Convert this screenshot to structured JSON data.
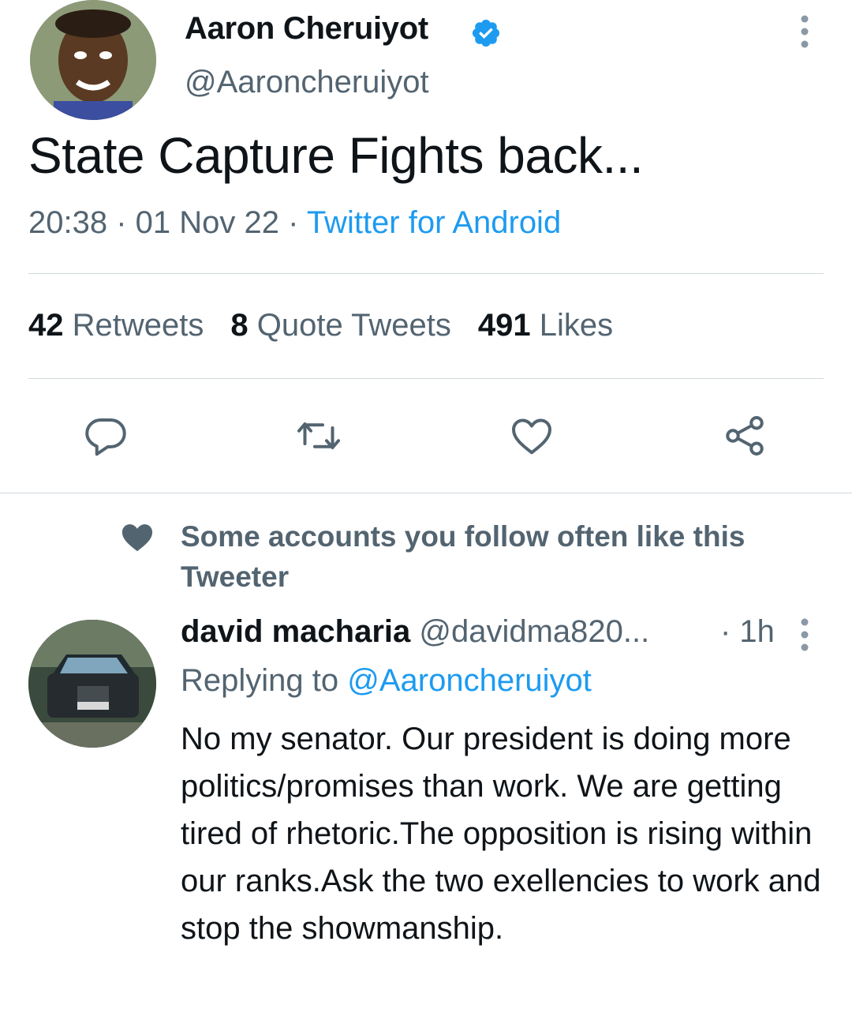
{
  "tweet": {
    "author_name": "Aaron Cheruiyot",
    "author_handle": "@Aaroncheruiyot",
    "text": "State Capture Fights back...",
    "time": "20:38",
    "date": "01 Nov 22",
    "source": "Twitter for Android",
    "separator": " · "
  },
  "stats": {
    "retweets_count": "42",
    "retweets_label": "Retweets",
    "quotes_count": "8",
    "quotes_label": "Quote Tweets",
    "likes_count": "491",
    "likes_label": "Likes"
  },
  "actions": [
    "reply-icon",
    "retweet-icon",
    "like-icon",
    "share-icon"
  ],
  "social_context": {
    "icon": "heart-icon",
    "text": "Some accounts you follow often like this Tweeter"
  },
  "reply": {
    "author_name": "david macharia",
    "author_handle": "@davidma820...",
    "time": "· 1h",
    "replying_prefix": "Replying to ",
    "replying_to": "@Aaroncheruiyot",
    "text": "No my senator. Our president is doing more politics/promises than work. We are getting tired of rhetoric.The opposition is rising within our ranks.Ask the two exellencies to work and stop the showmanship."
  },
  "colors": {
    "text_primary": "#0f1419",
    "text_secondary": "#536471",
    "accent": "#1d9bf0",
    "divider": "#cfd9de"
  }
}
